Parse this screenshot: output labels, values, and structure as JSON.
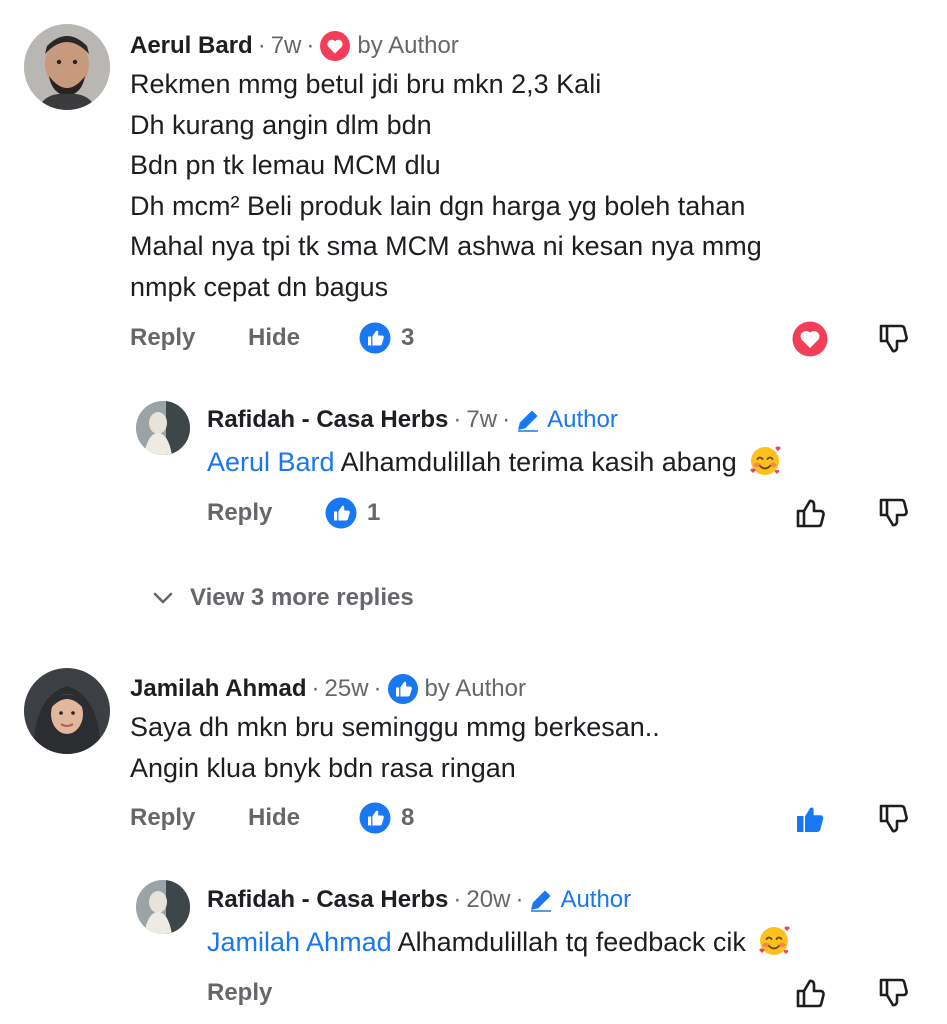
{
  "colors": {
    "accent": "#1877f2",
    "love": "#f33e58",
    "muted": "#65676b",
    "text": "#1c1e21"
  },
  "comments": [
    {
      "author": "Aerul Bard",
      "time": "7w",
      "badge_icon": "heart-badge-icon",
      "badge_text": "by Author",
      "lines": [
        "Rekmen mmg betul jdi bru mkn 2,3 Kali",
        "Dh kurang angin dlm bdn",
        "Bdn pn tk lemau MCM dlu",
        "Dh mcm² Beli produk lain dgn harga yg boleh tahan",
        "Mahal nya tpi tk sma MCM ashwa ni kesan nya mmg",
        "nmpk cepat dn bagus"
      ],
      "reply_label": "Reply",
      "hide_label": "Hide",
      "like_count": "3",
      "reaction_state": "love"
    },
    {
      "author": "Jamilah Ahmad",
      "time": "25w",
      "badge_icon": "like-badge-icon",
      "badge_text": "by Author",
      "lines": [
        "Saya dh mkn  bru seminggu mmg berkesan..",
        "Angin klua bnyk bdn rasa ringan"
      ],
      "reply_label": "Reply",
      "hide_label": "Hide",
      "like_count": "8",
      "reaction_state": "liked"
    }
  ],
  "replies": [
    {
      "author": "Rafidah - Casa Herbs",
      "time": "7w",
      "author_label": "Author",
      "mention": "Aerul Bard",
      "text": " Alhamdulillah terima kasih abang",
      "emoji": "smiling-face-with-hearts-emoji",
      "reply_label": "Reply",
      "like_count": "1"
    },
    {
      "author": "Rafidah - Casa Herbs",
      "time": "20w",
      "author_label": "Author",
      "mention": "Jamilah Ahmad",
      "text": " Alhamdulillah tq feedback cik",
      "emoji": "smiling-face-with-hearts-emoji",
      "reply_label": "Reply"
    }
  ],
  "view_more": "View 3 more replies"
}
